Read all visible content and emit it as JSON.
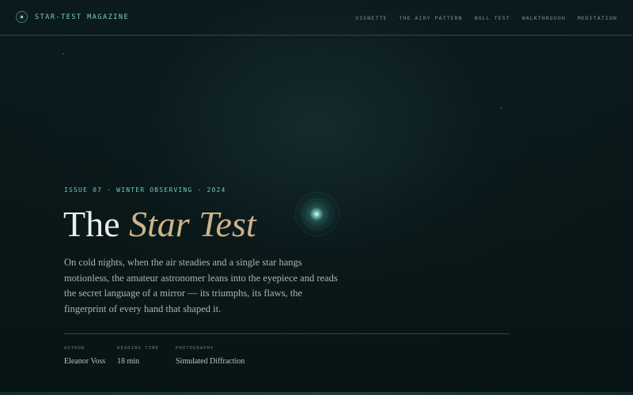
{
  "brand": {
    "name": "STAR-TEST MAGAZINE",
    "icon": "star-ring-icon"
  },
  "nav": [
    {
      "label": "VIGNETTE"
    },
    {
      "label": "THE AIRY PATTERN"
    },
    {
      "label": "NULL TEST"
    },
    {
      "label": "WALKTHROUGH"
    },
    {
      "label": "MEDITATION"
    }
  ],
  "hero": {
    "eyebrow": "ISSUE 07 · WINTER OBSERVING · 2024",
    "title_plain": "The ",
    "title_accent": "Star Test",
    "lede": "On cold nights, when the air steadies and a single star hangs motionless, the amateur astronomer leans into the eyepiece and reads the secret language of a mirror — its triumphs, its flaws, the fingerprint of every hand that shaped it."
  },
  "meta": {
    "author": {
      "label": "AUTHOR",
      "value": "Eleanor Voss"
    },
    "reading_time": {
      "label": "READING TIME",
      "value": "18 min"
    },
    "photography": {
      "label": "PHOTOGRAPHY",
      "value": "Simulated Diffraction"
    }
  },
  "colors": {
    "background": "#081416",
    "accent_teal": "#6fc8bb",
    "accent_gold": "#cdb38b",
    "heading": "#ecefe9"
  }
}
